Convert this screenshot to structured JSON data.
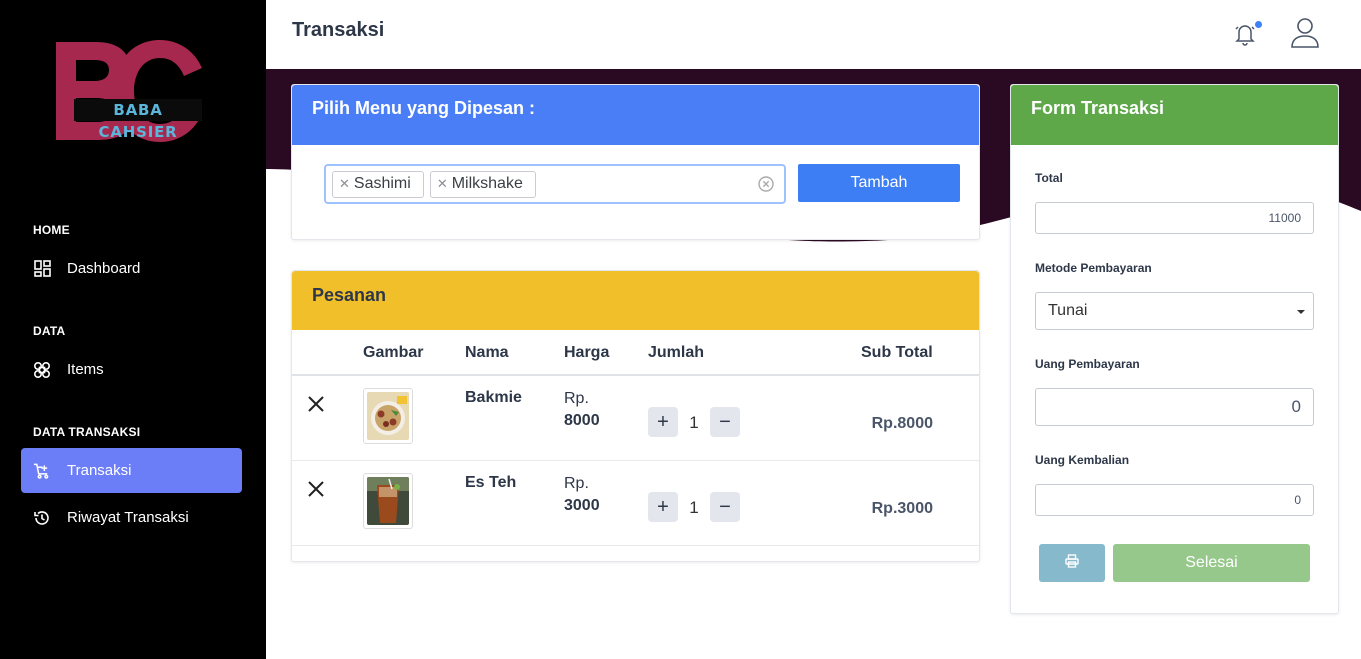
{
  "sidebar": {
    "logo_letters": "BC",
    "logo_text": "BABA CAHSIER",
    "sections": [
      {
        "heading": "HOME",
        "items": [
          {
            "label": "Dashboard",
            "icon": "dashboard-icon"
          }
        ]
      },
      {
        "heading": "DATA",
        "items": [
          {
            "label": "Items",
            "icon": "items-icon"
          }
        ]
      },
      {
        "heading": "DATA TRANSAKSI",
        "items": [
          {
            "label": "Transaksi",
            "icon": "cart-plus-icon",
            "active": true
          },
          {
            "label": "Riwayat Transaksi",
            "icon": "history-icon"
          }
        ]
      }
    ]
  },
  "header": {
    "title": "Transaksi",
    "icons": [
      "bell-icon",
      "user-icon"
    ]
  },
  "menu_card": {
    "title": "Pilih Menu yang Dipesan :",
    "selected": [
      "Sashimi",
      "Milkshake"
    ],
    "add_button": "Tambah"
  },
  "order_card": {
    "title": "Pesanan",
    "columns": [
      "Gambar",
      "Nama",
      "Harga",
      "Jumlah",
      "Sub Total"
    ],
    "rows": [
      {
        "nama": "Bakmie",
        "harga_prefix": "Rp.",
        "harga": "8000",
        "jumlah": "1",
        "subtotal": "Rp.8000"
      },
      {
        "nama": "Es Teh",
        "harga_prefix": "Rp.",
        "harga": "3000",
        "jumlah": "1",
        "subtotal": "Rp.3000"
      }
    ]
  },
  "form_card": {
    "title": "Form Transaksi",
    "total_label": "Total",
    "total_value": "11000",
    "metode_label": "Metode Pembayaran",
    "metode_value": "Tunai",
    "uang_label": "Uang Pembayaran",
    "uang_value": "0",
    "kembalian_label": "Uang Kembalian",
    "kembalian_value": "0",
    "print_icon": "printer-icon",
    "selesai_button": "Selesai"
  },
  "colors": {
    "sidebar_bg": "#000000",
    "active_nav": "#6c7ef7",
    "menu_header": "#4a7ef6",
    "order_header": "#f0bf2a",
    "form_header": "#5fa84a",
    "banner": "#2a0a22",
    "logo": "#a6284e"
  }
}
